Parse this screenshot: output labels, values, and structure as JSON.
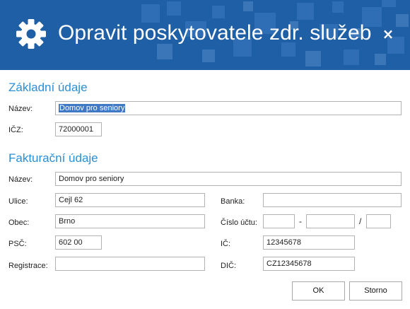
{
  "dialog": {
    "title": "Opravit poskytovatele zdr. služeb",
    "close_symbol": "×",
    "title_icon": "gear-icon"
  },
  "basic": {
    "heading": "Základní údaje",
    "name_label": "Název:",
    "name_value": "Domov pro seniory",
    "icz_label": "IČZ:",
    "icz_value": "72000001"
  },
  "billing": {
    "heading": "Fakturační údaje",
    "name_label": "Název:",
    "name_value": "Domov pro seniory",
    "street_label": "Ulice:",
    "street_value": "Cejl 62",
    "city_label": "Obec:",
    "city_value": "Brno",
    "zip_label": "PSČ:",
    "zip_value": "602 00",
    "registration_label": "Registrace:",
    "registration_value": "",
    "bank_label": "Banka:",
    "bank_value": "",
    "account_label": "Číslo účtu:",
    "account_prefix": "",
    "account_dash": "-",
    "account_number": "",
    "account_slash": "/",
    "bank_code": "",
    "ic_label": "IČ:",
    "ic_value": "12345678",
    "dic_label": "DIČ:",
    "dic_value": "CZ12345678"
  },
  "buttons": {
    "ok": "OK",
    "cancel": "Storno"
  },
  "colors": {
    "title_bar": "#1f5fa6",
    "section_heading": "#2b8fd6",
    "selection": "#3f78c4"
  }
}
